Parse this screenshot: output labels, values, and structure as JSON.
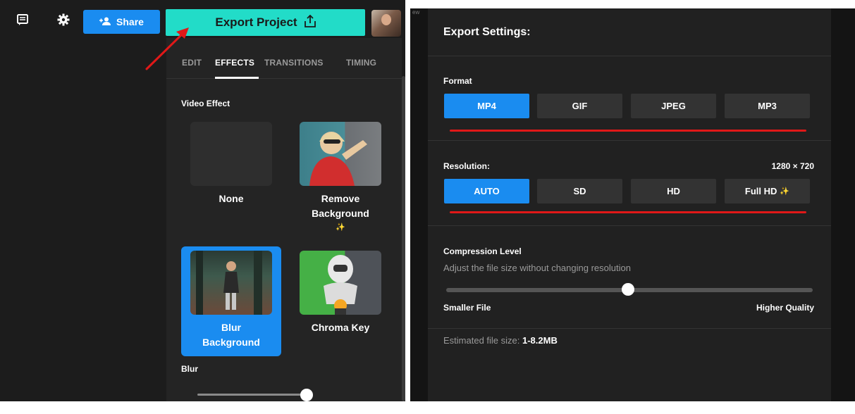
{
  "toolbar": {
    "share_label": "Share",
    "export_label": "Export Project"
  },
  "tabs": [
    {
      "label": "EDIT",
      "active": false
    },
    {
      "label": "EFFECTS",
      "active": true
    },
    {
      "label": "TRANSITIONS",
      "active": false
    },
    {
      "label": "TIMING",
      "active": false
    }
  ],
  "effects_panel": {
    "section_title": "Video Effect",
    "items": [
      {
        "label": "None",
        "selected": false
      },
      {
        "label_line1": "Remove",
        "label_line2": "Background",
        "sparkle": "✨",
        "selected": false
      },
      {
        "label_line1": "Blur",
        "label_line2": "Background",
        "selected": true
      },
      {
        "label": "Chroma Key",
        "selected": false
      }
    ],
    "blur_label": "Blur",
    "blur_level": 0.94
  },
  "export_settings": {
    "title": "Export Settings:",
    "format": {
      "label": "Format",
      "options": [
        "MP4",
        "GIF",
        "JPEG",
        "MP3"
      ],
      "selected": "MP4"
    },
    "resolution": {
      "label": "Resolution:",
      "value": "1280 × 720",
      "options": [
        "AUTO",
        "SD",
        "HD",
        "Full HD"
      ],
      "full_hd_sparkle": "✨",
      "selected": "AUTO"
    },
    "compression": {
      "label": "Compression Level",
      "description": "Adjust the file size without changing resolution",
      "min_label": "Smaller File",
      "max_label": "Higher Quality",
      "level": 0.5
    },
    "estimate": {
      "label": "Estimated file size:",
      "value": "1-8.2MB"
    }
  },
  "background_text": "ew",
  "colors": {
    "accent_blue": "#1a8cf0",
    "export_teal": "#22dcc8",
    "annotation_red": "#e01818",
    "panel_dark": "#212121"
  }
}
